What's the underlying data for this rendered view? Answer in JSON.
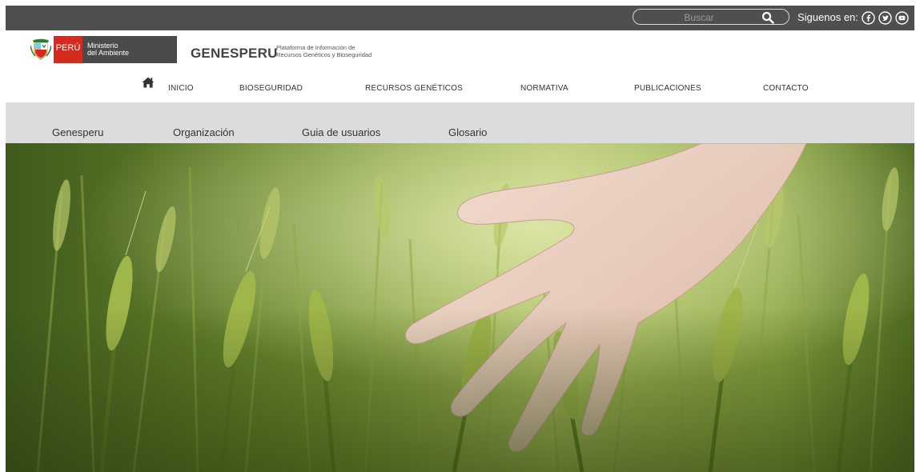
{
  "topbar": {
    "search_placeholder": "Buscar",
    "follow_label": "Siguenos en:",
    "social_icons": [
      "facebook-icon",
      "twitter-icon",
      "youtube-icon"
    ]
  },
  "header": {
    "peru_label": "PERÚ",
    "ministry_line1": "Ministerio",
    "ministry_line2": "del Ambiente",
    "brand": "GENESPERU",
    "brand_sub_line1": "Plataforma de Información de",
    "brand_sub_line2": "Recursos Genéticos y Bioseguridad"
  },
  "nav": {
    "items": [
      "INICIO",
      "BIOSEGURIDAD",
      "RECURSOS GENÉTICOS",
      "NORMATIVA",
      "PUBLICACIONES",
      "CONTACTO"
    ]
  },
  "subnav": {
    "items": [
      "Genesperu",
      "Organización",
      "Guia de usuarios",
      "Glosario"
    ]
  },
  "colors": {
    "topbar_bg": "#4f4f4f",
    "peru_red": "#d52b1e",
    "ministry_gray": "#4a4a4a",
    "subnav_bg": "#dcdcdc"
  }
}
